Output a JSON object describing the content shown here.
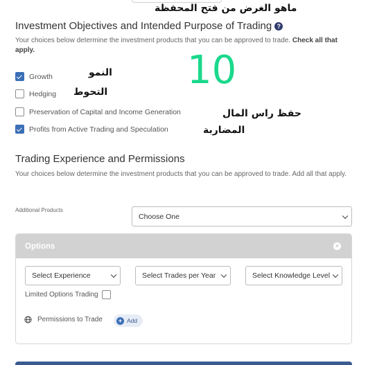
{
  "annotations": {
    "portfolio_purpose": "ماهو الغرض من فتح المحفظة",
    "growth": "النمو",
    "hedging": "التحوط",
    "capital_preservation": "حفظ راس المال",
    "speculation": "المضاربة",
    "number": "10",
    "number_color": "#1ad88c"
  },
  "objectives": {
    "title": "Investment Objectives and Intended Purpose of Trading",
    "help_icon": "question-circle-icon",
    "description": "Your choices below determine the investment products that you can be approved to trade.",
    "description_bold": "Check all that apply.",
    "options": [
      {
        "label": "Growth",
        "checked": true
      },
      {
        "label": "Hedging",
        "checked": false
      },
      {
        "label": "Preservation of Capital and Income Generation",
        "checked": false
      },
      {
        "label": "Profits from Active Trading and Speculation",
        "checked": true
      }
    ]
  },
  "experience": {
    "title": "Trading Experience and Permissions",
    "description": "Your choices below determine the investment products that you can be approved to trade. Add all that apply.",
    "additional_products_label": "Additional Products",
    "additional_products_value": "Choose One"
  },
  "options_panel": {
    "title": "Options",
    "select_experience": "Select Experience",
    "select_trades": "Select Trades per Year",
    "select_knowledge": "Select Knowledge Level",
    "limited_options_trading": "Limited Options Trading",
    "limited_options_checked": false,
    "permissions_label": "Permissions to Trade",
    "add_label": "Add"
  },
  "colors": {
    "accent": "#3b6fb6",
    "panel_header": "#d2d2d2",
    "bottom_bar": "#3b5a90"
  }
}
